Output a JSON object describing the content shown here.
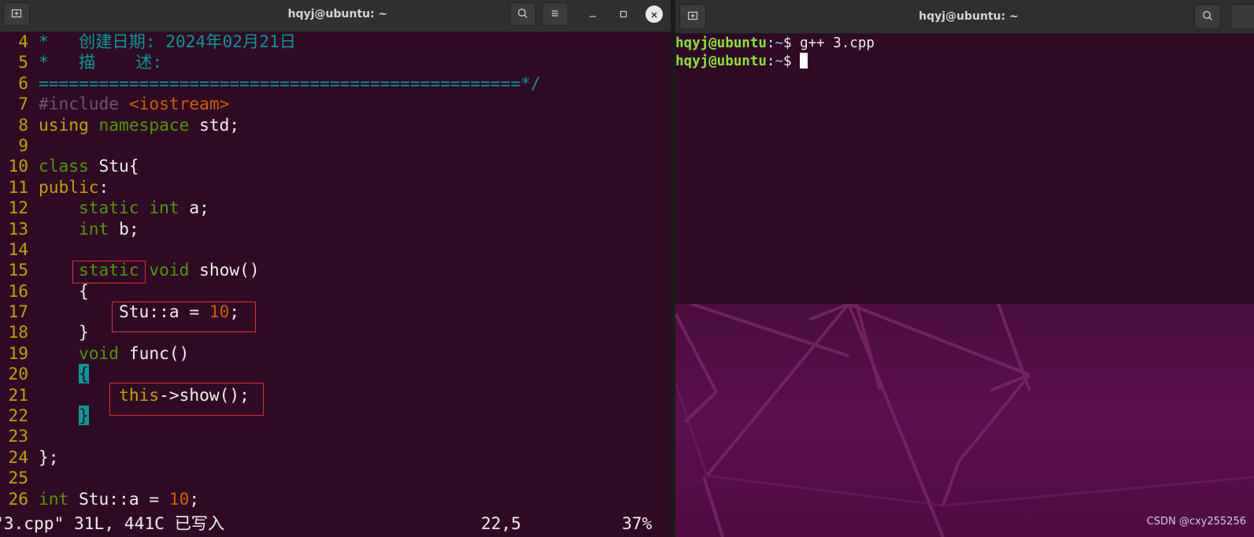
{
  "left_window": {
    "title": "hqyj@ubuntu: ~",
    "code_lines": [
      {
        "n": "4",
        "parts": [
          {
            "t": "*   创建日期: 2024年02月21日",
            "c": "c-cm"
          }
        ]
      },
      {
        "n": "5",
        "parts": [
          {
            "t": "*   描    述:",
            "c": "c-cm"
          }
        ]
      },
      {
        "n": "6",
        "parts": [
          {
            "t": "================================================*/",
            "c": "c-cm"
          }
        ]
      },
      {
        "n": "7",
        "parts": [
          {
            "t": "#include ",
            "c": "c-pp"
          },
          {
            "t": "<iostream>",
            "c": "c-str"
          }
        ]
      },
      {
        "n": "8",
        "parts": [
          {
            "t": "using ",
            "c": "c-this"
          },
          {
            "t": "namespace",
            "c": "c-kw"
          },
          {
            "t": " std;",
            "c": ""
          }
        ]
      },
      {
        "n": "9",
        "parts": []
      },
      {
        "n": "10",
        "parts": [
          {
            "t": "class",
            "c": "c-kw"
          },
          {
            "t": " Stu{",
            "c": ""
          }
        ]
      },
      {
        "n": "11",
        "parts": [
          {
            "t": "public",
            "c": "c-this"
          },
          {
            "t": ":",
            "c": ""
          }
        ]
      },
      {
        "n": "12",
        "parts": [
          {
            "t": "    ",
            "c": ""
          },
          {
            "t": "static",
            "c": "c-kw"
          },
          {
            "t": " ",
            "c": ""
          },
          {
            "t": "int",
            "c": "c-ty"
          },
          {
            "t": " a;",
            "c": ""
          }
        ]
      },
      {
        "n": "13",
        "parts": [
          {
            "t": "    ",
            "c": ""
          },
          {
            "t": "int",
            "c": "c-ty"
          },
          {
            "t": " b;",
            "c": ""
          }
        ]
      },
      {
        "n": "14",
        "parts": []
      },
      {
        "n": "15",
        "parts": [
          {
            "t": "    ",
            "c": ""
          },
          {
            "t": "static",
            "c": "c-kw"
          },
          {
            "t": " ",
            "c": ""
          },
          {
            "t": "void",
            "c": "c-ty"
          },
          {
            "t": " show()",
            "c": ""
          }
        ]
      },
      {
        "n": "16",
        "parts": [
          {
            "t": "    {",
            "c": ""
          }
        ]
      },
      {
        "n": "17",
        "parts": [
          {
            "t": "        Stu::a = ",
            "c": ""
          },
          {
            "t": "10",
            "c": "c-num"
          },
          {
            "t": ";",
            "c": ""
          }
        ]
      },
      {
        "n": "18",
        "parts": [
          {
            "t": "    }",
            "c": ""
          }
        ]
      },
      {
        "n": "19",
        "parts": [
          {
            "t": "    ",
            "c": ""
          },
          {
            "t": "void",
            "c": "c-ty"
          },
          {
            "t": " func()",
            "c": ""
          }
        ]
      },
      {
        "n": "20",
        "parts": [
          {
            "t": "    ",
            "c": ""
          },
          {
            "t": "{",
            "c": "hl-brace"
          }
        ]
      },
      {
        "n": "21",
        "parts": [
          {
            "t": "        ",
            "c": ""
          },
          {
            "t": "this",
            "c": "c-this"
          },
          {
            "t": "->show();",
            "c": ""
          }
        ]
      },
      {
        "n": "22",
        "parts": [
          {
            "t": "    ",
            "c": ""
          },
          {
            "t": "}",
            "c": "hl-brace"
          }
        ]
      },
      {
        "n": "23",
        "parts": []
      },
      {
        "n": "24",
        "parts": [
          {
            "t": "};",
            "c": ""
          }
        ]
      },
      {
        "n": "25",
        "parts": []
      },
      {
        "n": "26",
        "parts": [
          {
            "t": "int",
            "c": "c-ty"
          },
          {
            "t": " Stu::a = ",
            "c": ""
          },
          {
            "t": "10",
            "c": "c-num"
          },
          {
            "t": ";",
            "c": ""
          }
        ]
      }
    ],
    "status": {
      "file_info": "\"3.cpp\" 31L, 441C 已写入",
      "position": "22,5",
      "percent": "37%"
    }
  },
  "right_window": {
    "title": "hqyj@ubuntu: ~",
    "lines": [
      {
        "user": "hqyj@ubuntu",
        "sep": ":",
        "path": "~",
        "prompt": "$ ",
        "cmd": "g++ 3.cpp"
      },
      {
        "user": "hqyj@ubuntu",
        "sep": ":",
        "path": "~",
        "prompt": "$ ",
        "cmd": ""
      }
    ]
  },
  "watermark": "CSDN @cxy255256",
  "colors": {
    "terminal_bg": "#300a24",
    "line_number": "#c4a000",
    "comment": "#06989a",
    "keyword": "#4e9a06",
    "number": "#ce5c00",
    "prompt_user": "#8ae234",
    "prompt_path": "#729fcf",
    "annotation_box": "#e03030"
  },
  "icons": {
    "new_tab": "new-tab-icon",
    "search": "search-icon",
    "menu": "hamburger-menu-icon",
    "minimize": "minimize-icon",
    "maximize": "maximize-icon",
    "close": "close-icon"
  }
}
